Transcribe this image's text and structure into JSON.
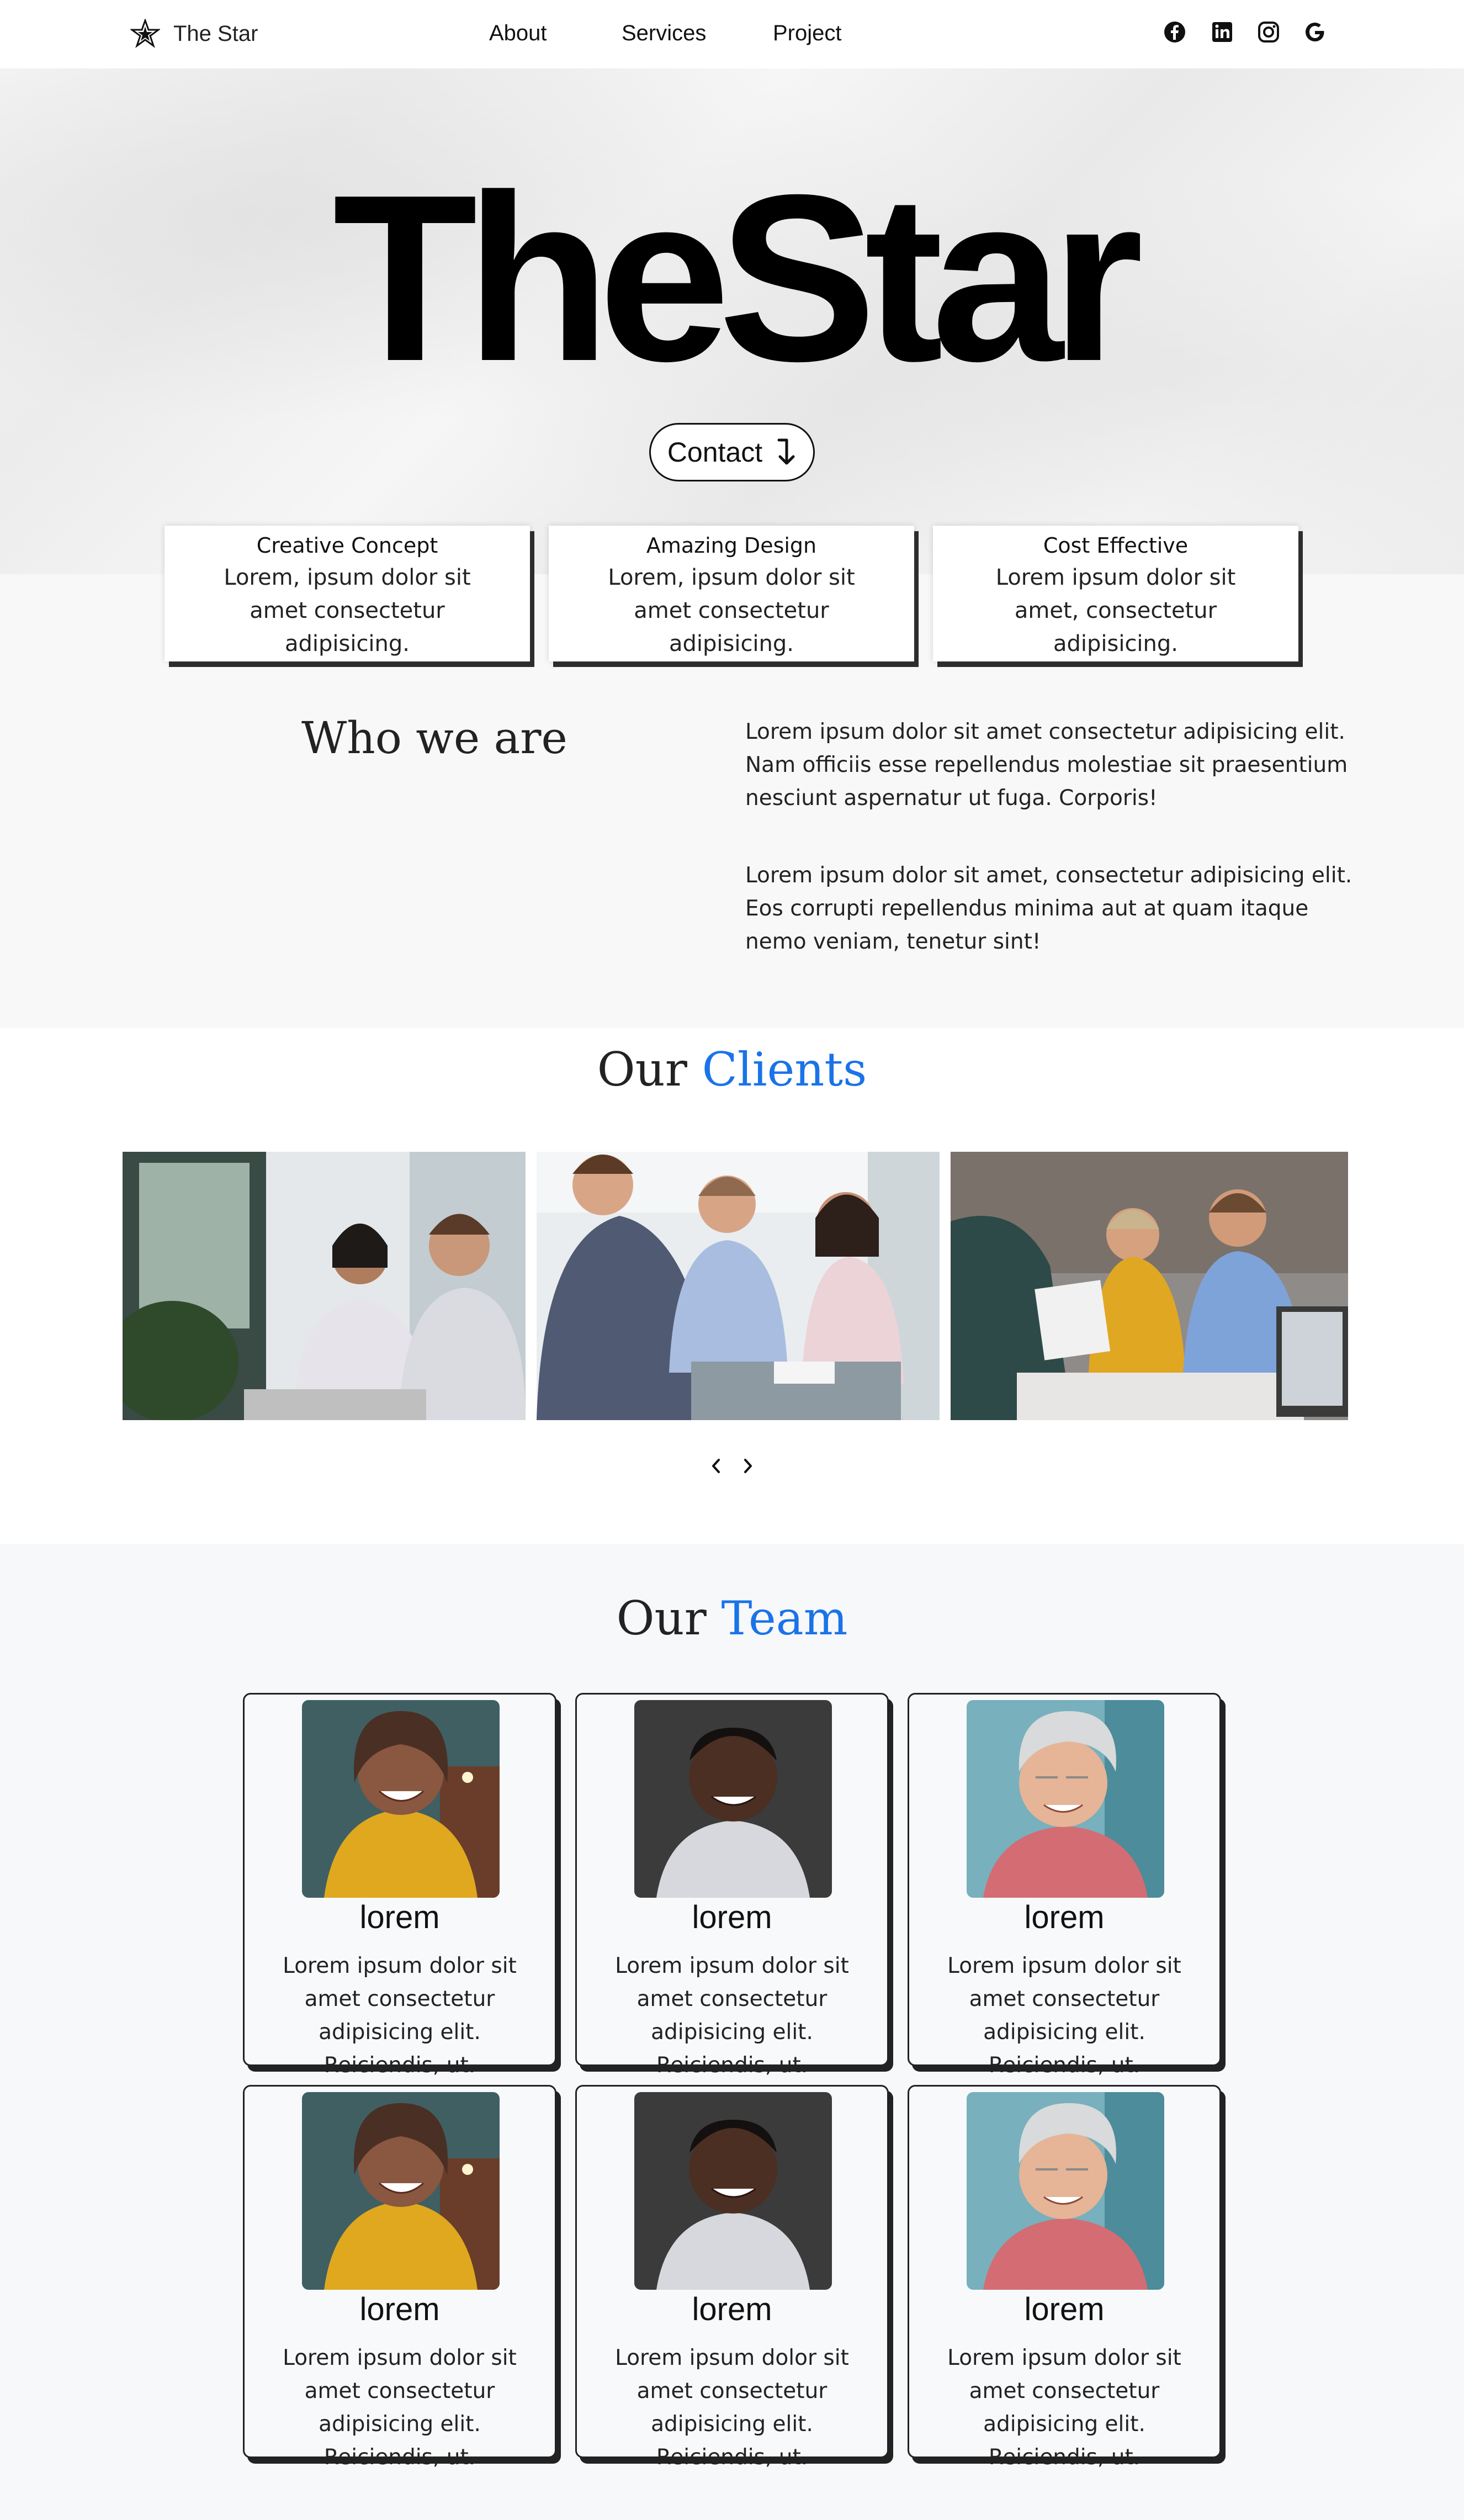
{
  "nav": {
    "brand": "The Star",
    "links": [
      "About",
      "Services",
      "Project"
    ],
    "social": [
      "facebook-icon",
      "linkedin-icon",
      "instagram-icon",
      "google-icon"
    ]
  },
  "hero": {
    "title": "TheStar",
    "contact_label": "Contact"
  },
  "features": [
    {
      "title": "Creative Concept",
      "text": "Lorem, ipsum dolor sit amet consectetur adipisicing."
    },
    {
      "title": "Amazing Design",
      "text": "Lorem, ipsum dolor sit amet consectetur adipisicing."
    },
    {
      "title": "Cost Effective",
      "text": "Lorem ipsum dolor sit amet, consectetur adipisicing."
    }
  ],
  "who": {
    "title": "Who we are",
    "para1": "Lorem ipsum dolor sit amet consectetur adipisicing elit. Nam officiis esse repellendus molestiae sit praesentium nesciunt aspernatur ut fuga. Corporis!",
    "para2": "Lorem ipsum dolor sit amet, consectetur adipisicing elit. Eos corrupti repellendus minima aut at quam itaque nemo veniam, tenetur sint!"
  },
  "clients": {
    "title_plain": "Our",
    "title_accent": "Clients"
  },
  "team": {
    "title_plain": "Our",
    "title_accent": "Team",
    "members": [
      {
        "name": "lorem",
        "text": "Lorem ipsum dolor sit amet consectetur adipisicing elit. Reiciendis, ut."
      },
      {
        "name": "lorem",
        "text": "Lorem ipsum dolor sit amet consectetur adipisicing elit. Reiciendis, ut."
      },
      {
        "name": "lorem",
        "text": "Lorem ipsum dolor sit amet consectetur adipisicing elit. Reiciendis, ut."
      },
      {
        "name": "lorem",
        "text": "Lorem ipsum dolor sit amet consectetur adipisicing elit. Reiciendis, ut."
      },
      {
        "name": "lorem",
        "text": "Lorem ipsum dolor sit amet consectetur adipisicing elit. Reiciendis, ut."
      },
      {
        "name": "lorem",
        "text": "Lorem ipsum dolor sit amet consectetur adipisicing elit. Reiciendis, ut."
      }
    ]
  },
  "colors": {
    "accent": "#1a73e8",
    "text": "#111111",
    "card_shadow": "#2d2d2d"
  }
}
